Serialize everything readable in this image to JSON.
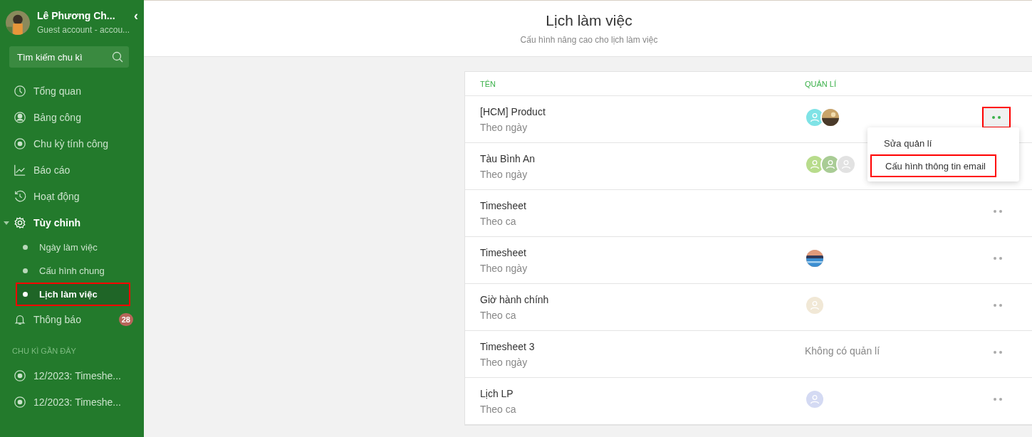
{
  "sidebar": {
    "profile": {
      "name": "Lê Phương Ch...",
      "subtitle": "Guest account - accou...",
      "collapse_icon": "‹"
    },
    "search": {
      "placeholder": "Tìm kiếm chu kì"
    },
    "items": [
      {
        "label": "Tổng quan",
        "expanded": false,
        "selected": false
      },
      {
        "label": "Bảng công",
        "expanded": false,
        "selected": false
      },
      {
        "label": "Chu kỳ tính công",
        "expanded": false,
        "selected": false
      },
      {
        "label": "Báo cáo",
        "expanded": false,
        "selected": false
      },
      {
        "label": "Hoạt động",
        "expanded": false,
        "selected": false
      },
      {
        "label": "Tùy chỉnh",
        "expanded": true,
        "selected": false,
        "children": [
          {
            "label": "Ngày làm việc",
            "selected": false,
            "highlighted": false
          },
          {
            "label": "Cấu hình chung",
            "selected": false,
            "highlighted": false
          },
          {
            "label": "Lịch làm việc",
            "selected": true,
            "highlighted": true
          }
        ]
      },
      {
        "label": "Thông báo",
        "expanded": false,
        "selected": false,
        "badge": "28"
      }
    ],
    "recent_title": "CHU KÌ GẦN ĐÂY",
    "recent": [
      {
        "label": "12/2023: Timeshe..."
      },
      {
        "label": "12/2023: Timeshe..."
      }
    ]
  },
  "header": {
    "title": "Lịch làm việc",
    "subtitle": "Cấu hình nâng cao cho lịch làm việc"
  },
  "table": {
    "columns": [
      "TÊN",
      "QUẢN LÍ"
    ],
    "rows": [
      {
        "name": "[HCM] Product",
        "type": "Theo ngày",
        "managers": [
          {
            "kind": "user",
            "color": "#7fe3e6"
          },
          {
            "kind": "picture"
          }
        ],
        "menu_open": true
      },
      {
        "name": "Tàu Bình An",
        "type": "Theo ngày",
        "managers": [
          {
            "kind": "user",
            "color": "#b8dc8c"
          },
          {
            "kind": "user",
            "color": "#a9cc95"
          },
          {
            "kind": "user",
            "color": "#e2e2e2"
          }
        ],
        "menu_open": false
      },
      {
        "name": "Timesheet",
        "type": "Theo ca",
        "managers": [],
        "menu_open": false
      },
      {
        "name": "Timesheet",
        "type": "Theo ngày",
        "managers": [
          {
            "kind": "picture"
          }
        ],
        "menu_open": false
      },
      {
        "name": "Giờ hành chính",
        "type": "Theo ca",
        "managers": [
          {
            "kind": "user",
            "color": "#f1e8d6"
          }
        ],
        "menu_open": false
      },
      {
        "name": "Timesheet 3",
        "type": "Theo ngày",
        "no_manager": "Không có quản lí",
        "menu_open": false
      },
      {
        "name": "Lịch LP",
        "type": "Theo ca",
        "managers": [
          {
            "kind": "user",
            "color": "#d4daf3"
          }
        ],
        "menu_open": false
      }
    ]
  },
  "row_menu": {
    "items": [
      {
        "label": "Sửa quản lí",
        "highlighted": false
      },
      {
        "label": "Cấu hình thông tin email",
        "highlighted": true
      }
    ]
  }
}
